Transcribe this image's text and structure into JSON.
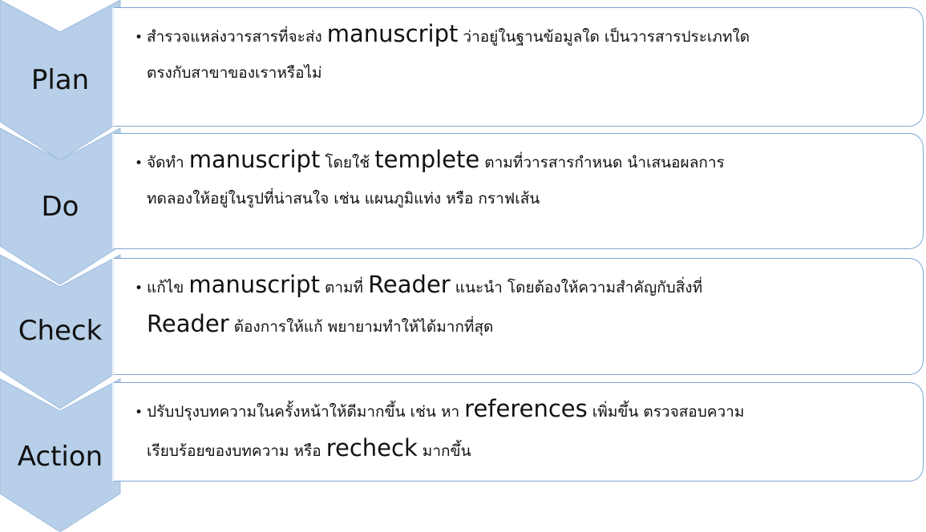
{
  "steps": [
    {
      "label": "Plan",
      "lines": [
        [
          {
            "t": "สำรวจแหล่งวารสารที่จะส่ง "
          },
          {
            "t": "manuscript",
            "big": true
          },
          {
            "t": " ว่าอยู่ในฐานข้อมูลใด เป็นวารสารประเภทใด"
          }
        ],
        [
          {
            "t": "ตรงกับสาขาของเราหรือไม่"
          }
        ]
      ]
    },
    {
      "label": "Do",
      "lines": [
        [
          {
            "t": "จัดทำ "
          },
          {
            "t": "manuscript",
            "big": true
          },
          {
            "t": " โดยใช้ "
          },
          {
            "t": "templete",
            "big": true
          },
          {
            "t": " ตามที่วารสารกำหนด นำเสนอผลการ"
          }
        ],
        [
          {
            "t": "ทดลองให้อยู่ในรูปที่น่าสนใจ เช่น แผนภูมิแท่ง หรือ กราฟเส้น"
          }
        ]
      ]
    },
    {
      "label": "Check",
      "lines": [
        [
          {
            "t": "แก้ไข "
          },
          {
            "t": "manuscript",
            "big": true
          },
          {
            "t": " ตามที่ "
          },
          {
            "t": "Reader",
            "big": true
          },
          {
            "t": " แนะนำ โดยต้องให้ความสำคัญกับสิ่งที่"
          }
        ],
        [
          {
            "t": "Reader",
            "big": true
          },
          {
            "t": " ต้องการให้แก้ พยายามทำให้ได้มากที่สุด"
          }
        ]
      ]
    },
    {
      "label": "Action",
      "lines": [
        [
          {
            "t": "ปรับปรุงบทความในครั้งหน้าให้ดีมากขึ้น เช่น หา "
          },
          {
            "t": "references",
            "big": true
          },
          {
            "t": " เพิ่มขึ้น ตรวจสอบความ"
          }
        ],
        [
          {
            "t": "เรียบร้อยของบทความ หรือ "
          },
          {
            "t": "recheck",
            "big": true
          },
          {
            "t": " มากขึ้น"
          }
        ]
      ]
    }
  ],
  "colors": {
    "chevron_fill": "#b7cfe8",
    "chevron_stroke": "#9fbde0",
    "box_border": "#7da6d4"
  },
  "bullet_char": "•"
}
